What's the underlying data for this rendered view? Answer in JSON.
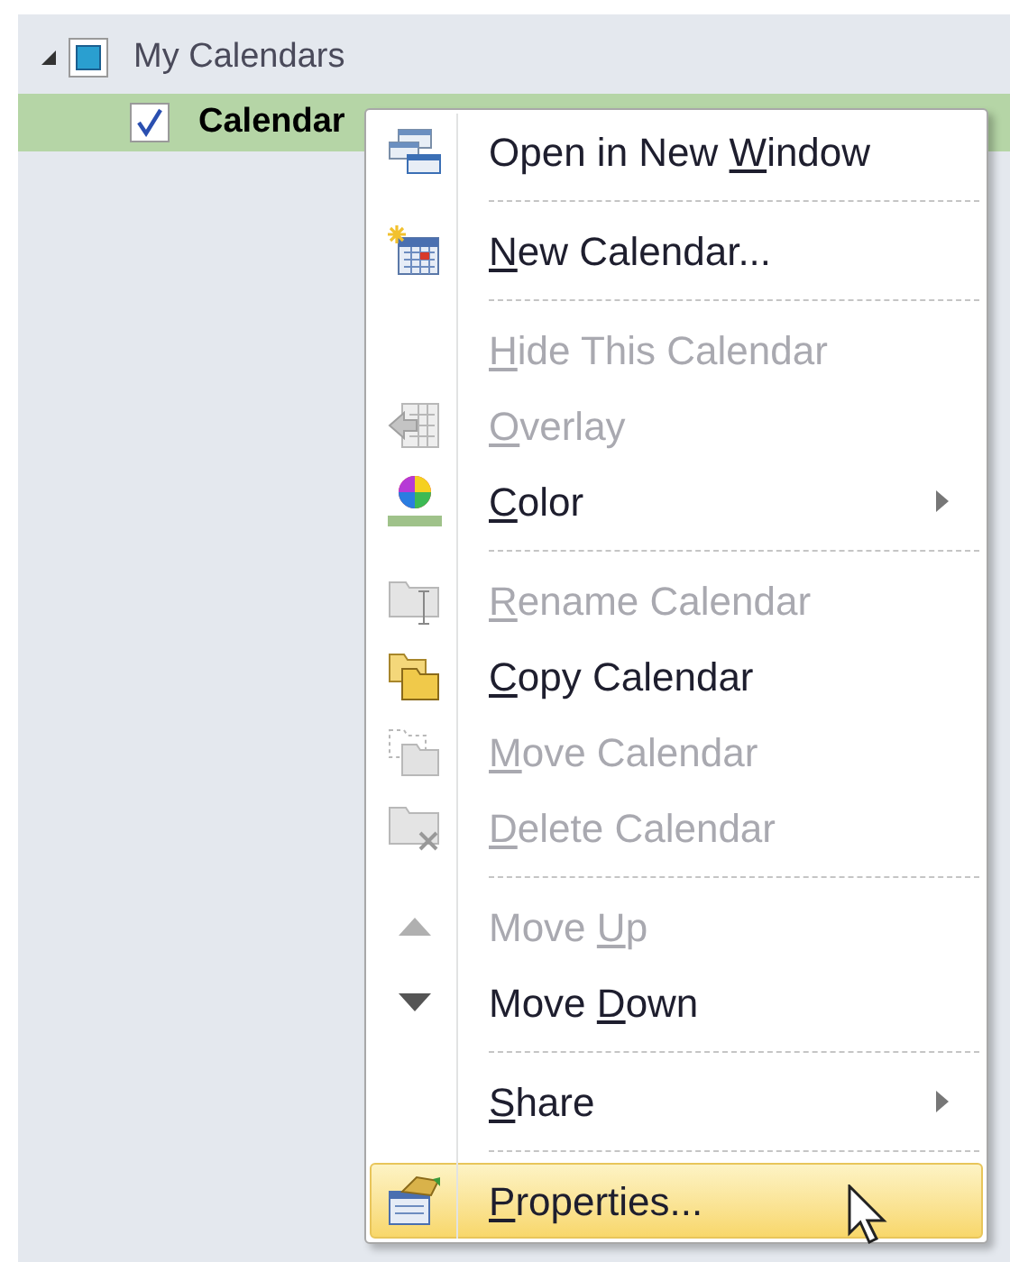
{
  "tree": {
    "group": {
      "label": "My Calendars",
      "expanded": true,
      "checked": false
    },
    "items": [
      {
        "label": "Calendar",
        "checked": true,
        "selected": true
      }
    ]
  },
  "context_menu": {
    "items": [
      {
        "kind": "item",
        "label": {
          "before": "Open in New ",
          "key": "W",
          "after": "indow"
        },
        "disabled": false,
        "submenu": false,
        "selected": false
      },
      {
        "kind": "separator"
      },
      {
        "kind": "item",
        "label": {
          "key": "N",
          "after": "ew Calendar..."
        },
        "disabled": false,
        "submenu": false,
        "selected": false
      },
      {
        "kind": "separator"
      },
      {
        "kind": "item",
        "label": {
          "key": "H",
          "after": "ide This Calendar"
        },
        "disabled": true,
        "submenu": false,
        "selected": false
      },
      {
        "kind": "item",
        "label": {
          "key": "O",
          "after": "verlay"
        },
        "disabled": true,
        "submenu": false,
        "selected": false
      },
      {
        "kind": "item",
        "label": {
          "key": "C",
          "after": "olor"
        },
        "disabled": false,
        "submenu": true,
        "selected": false
      },
      {
        "kind": "separator"
      },
      {
        "kind": "item",
        "label": {
          "key": "R",
          "after": "ename Calendar"
        },
        "disabled": true,
        "submenu": false,
        "selected": false
      },
      {
        "kind": "item",
        "label": {
          "key": "C",
          "after": "opy Calendar"
        },
        "disabled": false,
        "submenu": false,
        "selected": false
      },
      {
        "kind": "item",
        "label": {
          "key": "M",
          "after": "ove Calendar"
        },
        "disabled": true,
        "submenu": false,
        "selected": false
      },
      {
        "kind": "item",
        "label": {
          "key": "D",
          "after": "elete Calendar"
        },
        "disabled": true,
        "submenu": false,
        "selected": false
      },
      {
        "kind": "separator"
      },
      {
        "kind": "item",
        "label": {
          "before": "Move ",
          "key": "U",
          "after": "p"
        },
        "disabled": true,
        "submenu": false,
        "selected": false
      },
      {
        "kind": "item",
        "label": {
          "before": "Move ",
          "key": "D",
          "after": "own"
        },
        "disabled": false,
        "submenu": false,
        "selected": false
      },
      {
        "kind": "separator"
      },
      {
        "kind": "item",
        "label": {
          "key": "S",
          "after": "hare"
        },
        "disabled": false,
        "submenu": true,
        "selected": false
      },
      {
        "kind": "separator"
      },
      {
        "kind": "item",
        "label": {
          "key": "P",
          "after": "roperties..."
        },
        "disabled": false,
        "submenu": false,
        "selected": true
      }
    ]
  }
}
